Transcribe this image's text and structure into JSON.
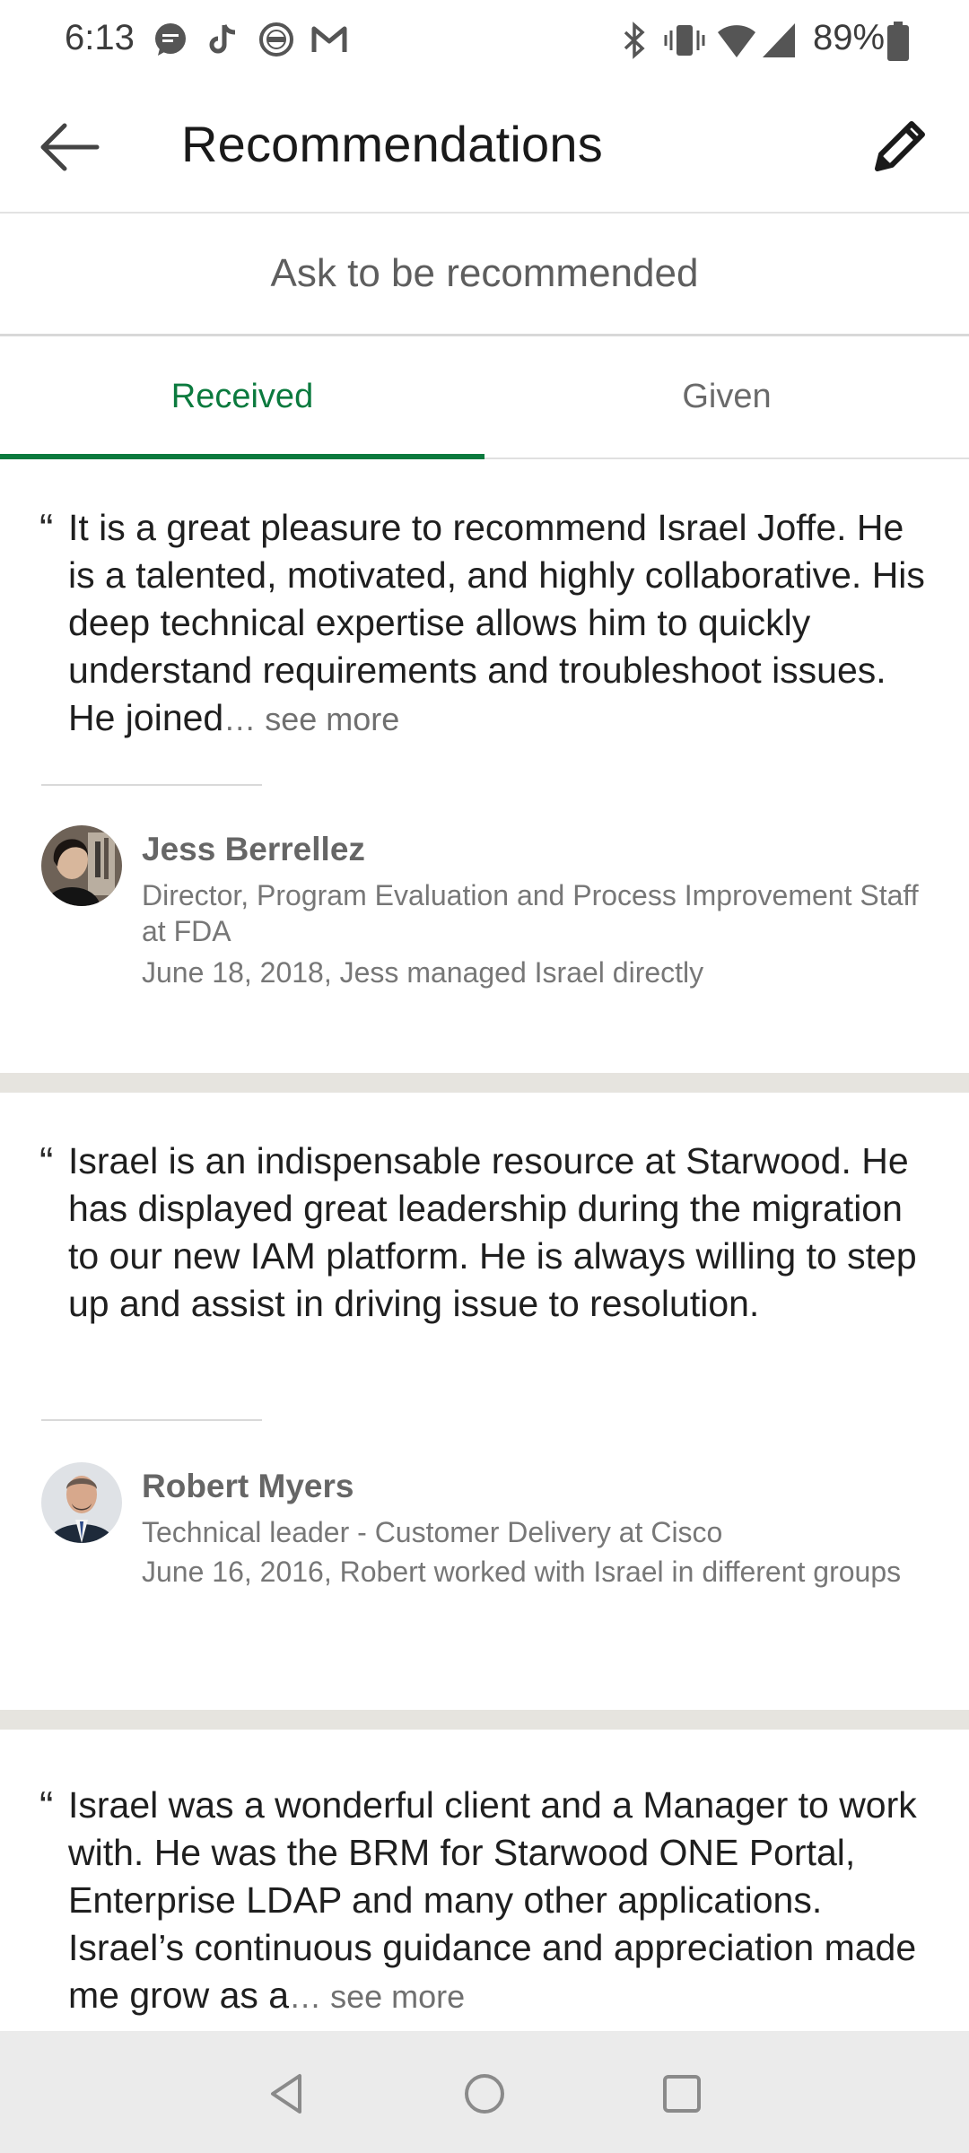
{
  "status_bar": {
    "time": "6:13",
    "battery": "89%",
    "left_icons": [
      "messages-icon",
      "tiktok-icon",
      "wsop-icon",
      "gmail-icon"
    ],
    "right_icons": [
      "bluetooth-icon",
      "vibrate-icon",
      "wifi-icon",
      "signal-icon",
      "battery-icon"
    ]
  },
  "app_bar": {
    "title": "Recommendations",
    "back_icon": "arrow-left-icon",
    "edit_icon": "pencil-icon"
  },
  "ask": {
    "label": "Ask to be recommended"
  },
  "tabs": [
    {
      "label": "Received",
      "active": true
    },
    {
      "label": "Given",
      "active": false
    }
  ],
  "recommendations": [
    {
      "quote": "It is a great pleasure to recommend Israel Joffe. He is a talented, motivated, and highly collaborative. His deep technical expertise allows him to quickly understand requirements and troubleshoot issues. He joined",
      "see_more": "… see more",
      "name": "Jess Berrellez",
      "title": "Director, Program Evaluation and Process Improvement Staff at FDA",
      "meta": "June 18, 2018, Jess managed Israel directly"
    },
    {
      "quote": "Israel is an indispensable resource at Starwood. He has displayed great leadership during the migration to our new IAM platform.   He is always willing to step up and assist in driving issue to resolution.",
      "see_more": "",
      "name": "Robert Myers",
      "title": "Technical leader - Customer Delivery at Cisco",
      "meta": "June 16, 2016, Robert worked with Israel in different groups"
    },
    {
      "quote": "Israel was a wonderful client and a Manager to work with. He was the BRM for Starwood ONE Portal, Enterprise LDAP and many other applications. Israel’s continuous guidance and appreciation made me grow as a",
      "see_more": "… see more",
      "name": "",
      "title": "",
      "meta": ""
    }
  ],
  "colors": {
    "accent": "#0b7a3e",
    "separator": "#e6e4df",
    "nav_bar": "#ebebeb"
  },
  "nav_bar": {
    "buttons": [
      "back-triangle-icon",
      "home-circle-icon",
      "recents-square-icon"
    ]
  }
}
